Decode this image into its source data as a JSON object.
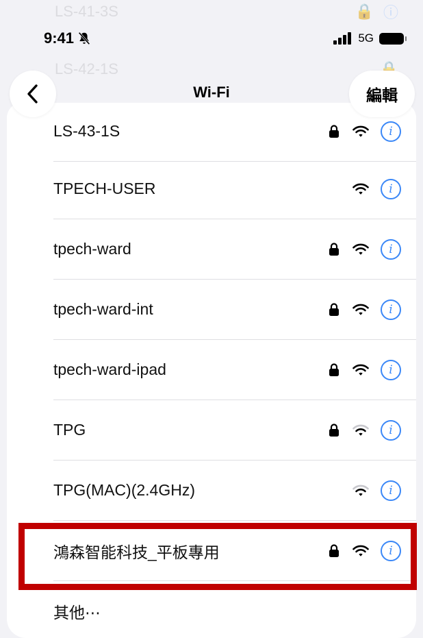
{
  "ghost_rows": [
    {
      "name": "LS-41-3S"
    },
    {
      "name": "LS-42-1S"
    }
  ],
  "status_bar": {
    "time": "9:41",
    "network": "5G",
    "icons": [
      "bell-slash-icon",
      "cellular-signal-icon",
      "battery-icon"
    ]
  },
  "nav": {
    "back_icon": "chevron-left-icon",
    "title": "Wi-Fi",
    "edit_label": "編輯"
  },
  "networks": [
    {
      "name": "LS-43-1S",
      "secured": true,
      "signal": "full"
    },
    {
      "name": "TPECH-USER",
      "secured": false,
      "signal": "full"
    },
    {
      "name": "tpech-ward",
      "secured": true,
      "signal": "full"
    },
    {
      "name": "tpech-ward-int",
      "secured": true,
      "signal": "full"
    },
    {
      "name": "tpech-ward-ipad",
      "secured": true,
      "signal": "full"
    },
    {
      "name": "TPG",
      "secured": true,
      "signal": "medium"
    },
    {
      "name": "TPG(MAC)(2.4GHz)",
      "secured": false,
      "signal": "medium"
    },
    {
      "name": "鴻森智能科技_平板專用",
      "secured": true,
      "signal": "full",
      "highlighted": true
    }
  ],
  "other_label": "其他⋯",
  "colors": {
    "accent": "#3a87f7",
    "highlight": "#c00000",
    "background": "#f2f2f6"
  }
}
